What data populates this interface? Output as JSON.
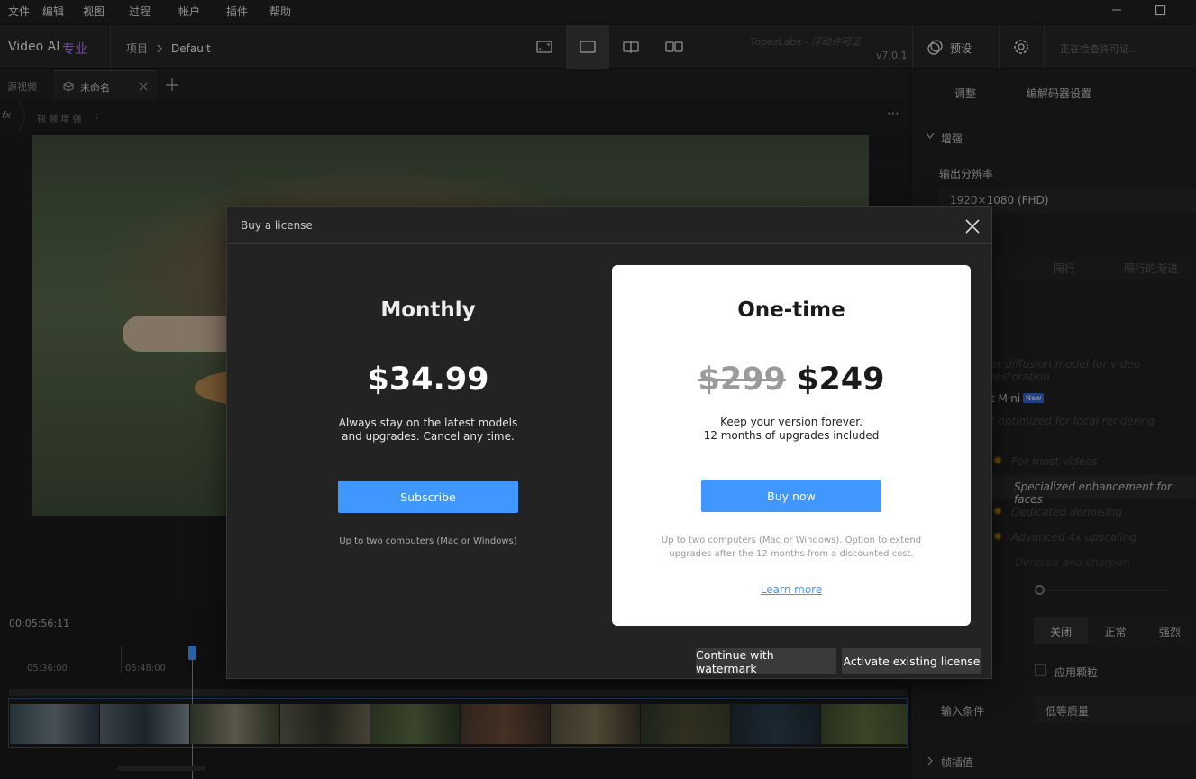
{
  "menu": [
    "文件",
    "编辑",
    "视图",
    "过程",
    "帐户",
    "插件",
    "帮助"
  ],
  "app": {
    "name": "Video AI",
    "edition": "专业",
    "breadcrumb_root": "项目",
    "breadcrumb_current": "Default",
    "brand": "TopazLabs - 浮动许可证",
    "version": "v7.0.1",
    "preset_label": "预设",
    "license_status": "正在检查许可证..."
  },
  "tabs": {
    "source": "源视频",
    "unnamed": "未命名"
  },
  "fx_label": "视 频 增 强",
  "fx_extra": ";",
  "right": {
    "tab_adjust": "调整",
    "tab_codec": "编解码器设置",
    "section_enhance": "增强",
    "output_res_label": "输出分辨率",
    "output_res_value": "1920×1080 (FHD)",
    "row_tabs": [
      "隔行",
      "隔行的渐进"
    ],
    "desc1": "er diffusion model for video restoration",
    "model_mini": "t Mini",
    "new_badge": "New",
    "desc_mini": "t optimized for local rendering",
    "opt1": "For most videos",
    "opt2": "Specialized enhancement for faces",
    "opt3": "Dedicated denoising",
    "opt4": "Advanced 4x upscaling",
    "opt5": "Denoise and sharpen",
    "seg": [
      "关闭",
      "正常",
      "强烈"
    ],
    "grain_label": "应用颗粒",
    "input_label": "输入条件",
    "input_value": "低等质量",
    "interp_label": "帧插值"
  },
  "timeline": {
    "timecode": "00:05:56:11",
    "ticks": [
      "05:36:00",
      "05:48:00"
    ]
  },
  "modal": {
    "title": "Buy a license",
    "monthly": {
      "title": "Monthly",
      "price": "$34.99",
      "desc1": "Always stay on the latest models",
      "desc2": "and upgrades. Cancel any time.",
      "button": "Subscribe",
      "note": "Up to two computers (Mac or Windows)"
    },
    "onetime": {
      "title": "One-time",
      "old_price": "$299",
      "price": "$249",
      "desc1": "Keep your version forever.",
      "desc2": "12 months of upgrades included",
      "button": "Buy now",
      "note1": "Up to two computers (Mac or Windows). Option to extend",
      "note2": "upgrades after the 12 months from a discounted cost.",
      "link": "Learn more"
    },
    "continue_watermark": "Continue with watermark",
    "activate": "Activate existing license"
  },
  "colors": {
    "accent": "#3f97ff",
    "purple": "#b070ff",
    "new_badge": "#3466c8"
  }
}
